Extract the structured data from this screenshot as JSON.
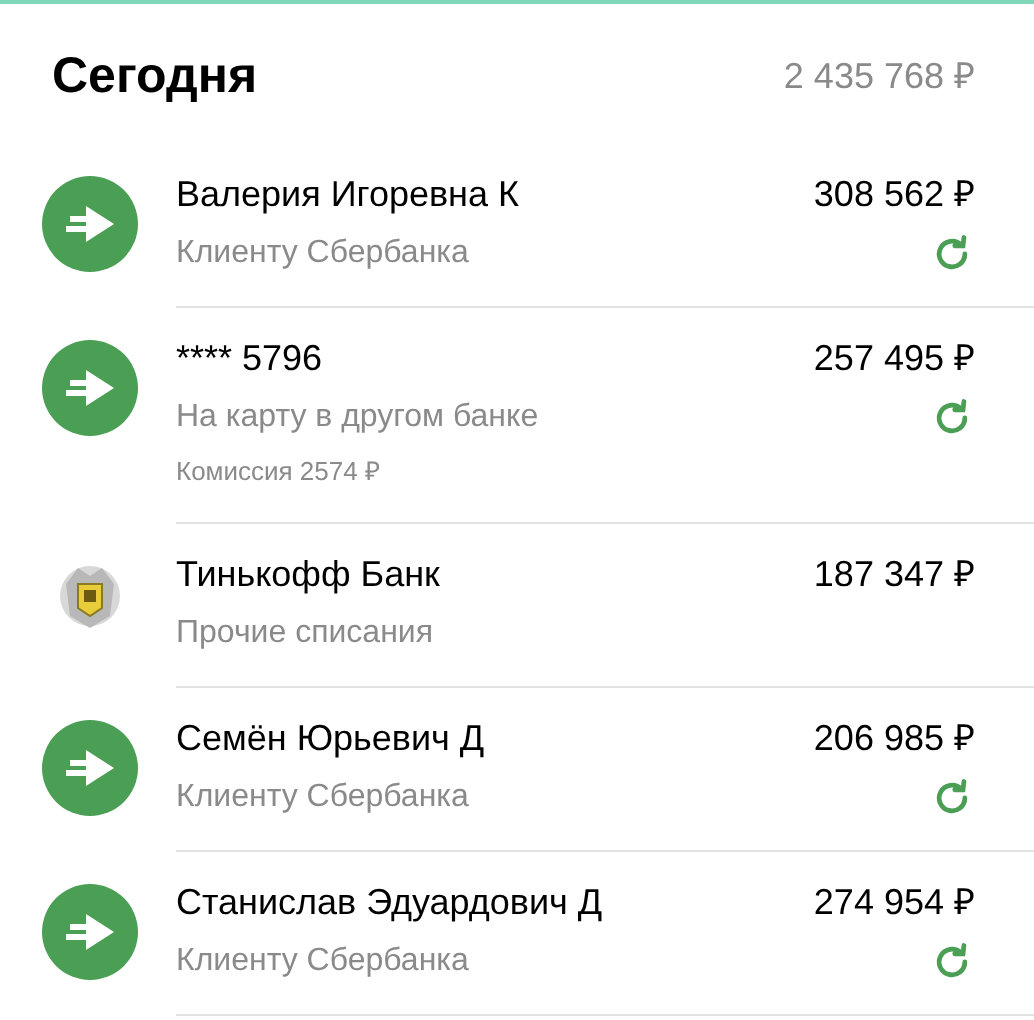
{
  "section": {
    "title": "Сегодня",
    "total": "2 435 768 ₽"
  },
  "operations": [
    {
      "kind": "transfer",
      "name": "Валерия Игоревна К",
      "category": "Клиенту Сбербанка",
      "amount": "308 562 ₽",
      "repeatable": true
    },
    {
      "kind": "transfer",
      "name": "**** 5796",
      "category": "На карту в другом банке",
      "note": "Комиссия 2574 ₽",
      "amount": "257 495 ₽",
      "repeatable": true
    },
    {
      "kind": "bank",
      "name": "Тинькофф Банк",
      "category": "Прочие списания",
      "amount": "187 347 ₽",
      "repeatable": false
    },
    {
      "kind": "transfer",
      "name": "Семён Юрьевич Д",
      "category": "Клиенту Сбербанка",
      "amount": "206 985 ₽",
      "repeatable": true
    },
    {
      "kind": "transfer",
      "name": "Станислав Эдуардович Д",
      "category": "Клиенту Сбербанка",
      "amount": "274 954 ₽",
      "repeatable": true
    }
  ]
}
